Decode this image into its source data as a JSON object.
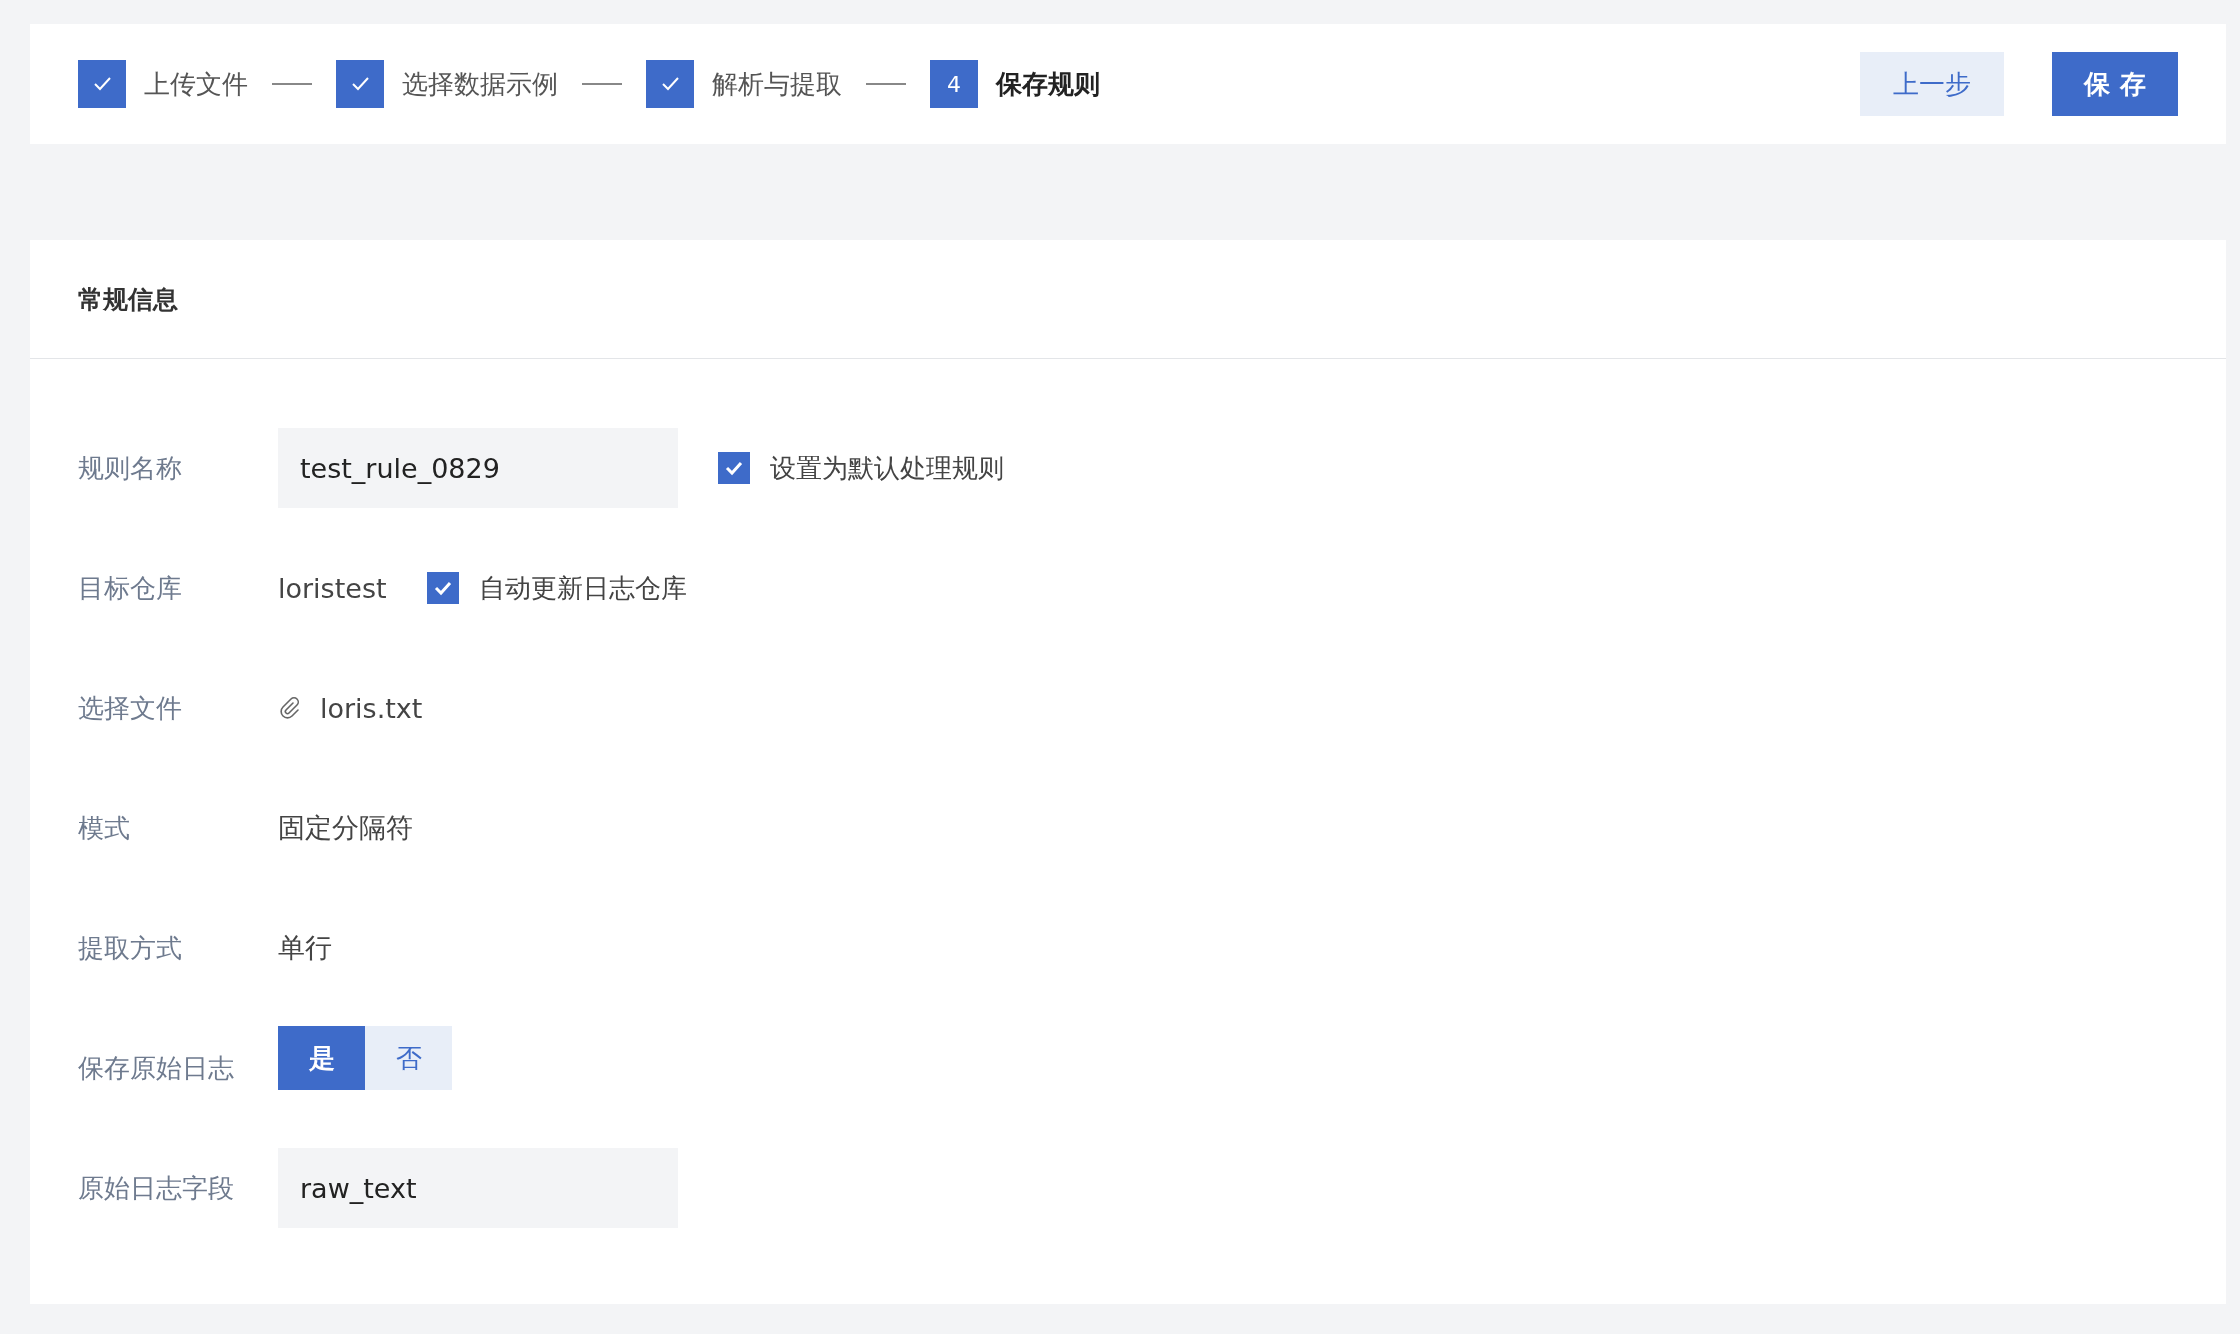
{
  "steps": [
    {
      "label": "上传文件",
      "done": true
    },
    {
      "label": "选择数据示例",
      "done": true
    },
    {
      "label": "解析与提取",
      "done": true
    },
    {
      "label": "保存规则",
      "done": false,
      "number": "4"
    }
  ],
  "buttons": [
    {
      "label": "上一步",
      "kind": "secondary"
    },
    {
      "label": "保 存",
      "kind": "primary"
    }
  ],
  "section": {
    "title": "常规信息"
  },
  "fields": [
    {
      "kind": "input",
      "label": "规则名称",
      "value": "test_rule_0829",
      "option": {
        "label": "设置为默认处理规则",
        "checked": true
      }
    },
    {
      "kind": "text",
      "label": "目标仓库",
      "value": "loristest",
      "option": {
        "label": "自动更新日志仓库",
        "checked": true
      }
    },
    {
      "kind": "file",
      "label": "选择文件",
      "value": "loris.txt"
    },
    {
      "kind": "text",
      "label": "模式",
      "value": "固定分隔符"
    },
    {
      "kind": "text",
      "label": "提取方式",
      "value": "单行"
    },
    {
      "kind": "toggle",
      "label": "保存原始日志",
      "options": [
        {
          "label": "是",
          "selected": true
        },
        {
          "label": "否",
          "selected": false
        }
      ]
    },
    {
      "kind": "input",
      "label": "原始日志字段",
      "value": "raw_text"
    }
  ]
}
